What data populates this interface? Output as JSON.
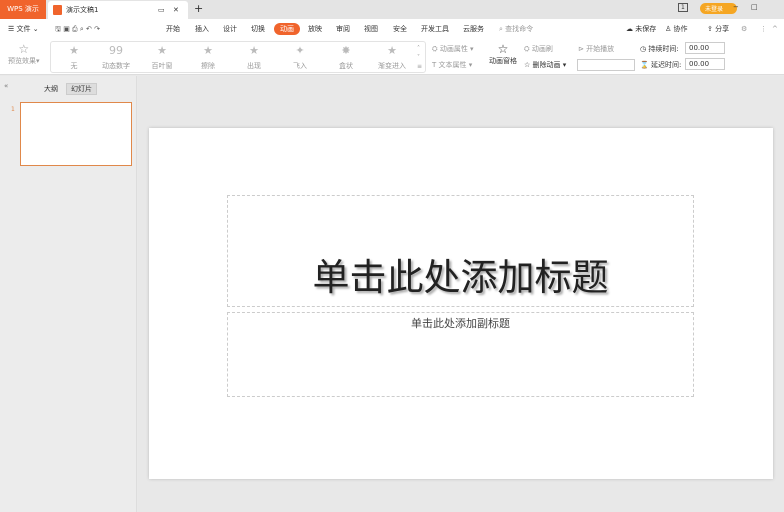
{
  "titlebar": {
    "app": "WPS 演示",
    "doc": "演示文稿1",
    "new_tab": "+",
    "page_indicator": "1",
    "user": "未登录",
    "min": "−",
    "max": "□"
  },
  "menubar": {
    "file": "文件",
    "tabs": [
      "开始",
      "插入",
      "设计",
      "切换",
      "动画",
      "放映",
      "审阅",
      "视图",
      "安全",
      "开发工具",
      "云服务"
    ],
    "active_tab": "动画",
    "search": "查找命令",
    "unsaved": "未保存",
    "collab": "协作",
    "share": "分享"
  },
  "ribbon": {
    "preview": "预览效果",
    "effects": [
      "无",
      "动态数字",
      "百叶窗",
      "擦除",
      "出现",
      "飞入",
      "盒状",
      "渐变进入"
    ],
    "anim_props": "动画属性",
    "text_props": "文本属性",
    "anim_pane": "动画窗格",
    "anim_brush": "动画刷",
    "delete_anim": "删除动画",
    "start_play": "开始播放",
    "duration_label": "持续时间:",
    "duration": "00.00",
    "delay_label": "延迟时间:",
    "delay": "00.00"
  },
  "leftpanel": {
    "tabs": [
      "大纲",
      "幻灯片"
    ],
    "active_tab": "幻灯片",
    "slide_number": "1"
  },
  "slide": {
    "title_placeholder": "单击此处添加标题",
    "subtitle_placeholder": "单击此处添加副标题"
  },
  "colors": {
    "accent": "#f0642c"
  }
}
